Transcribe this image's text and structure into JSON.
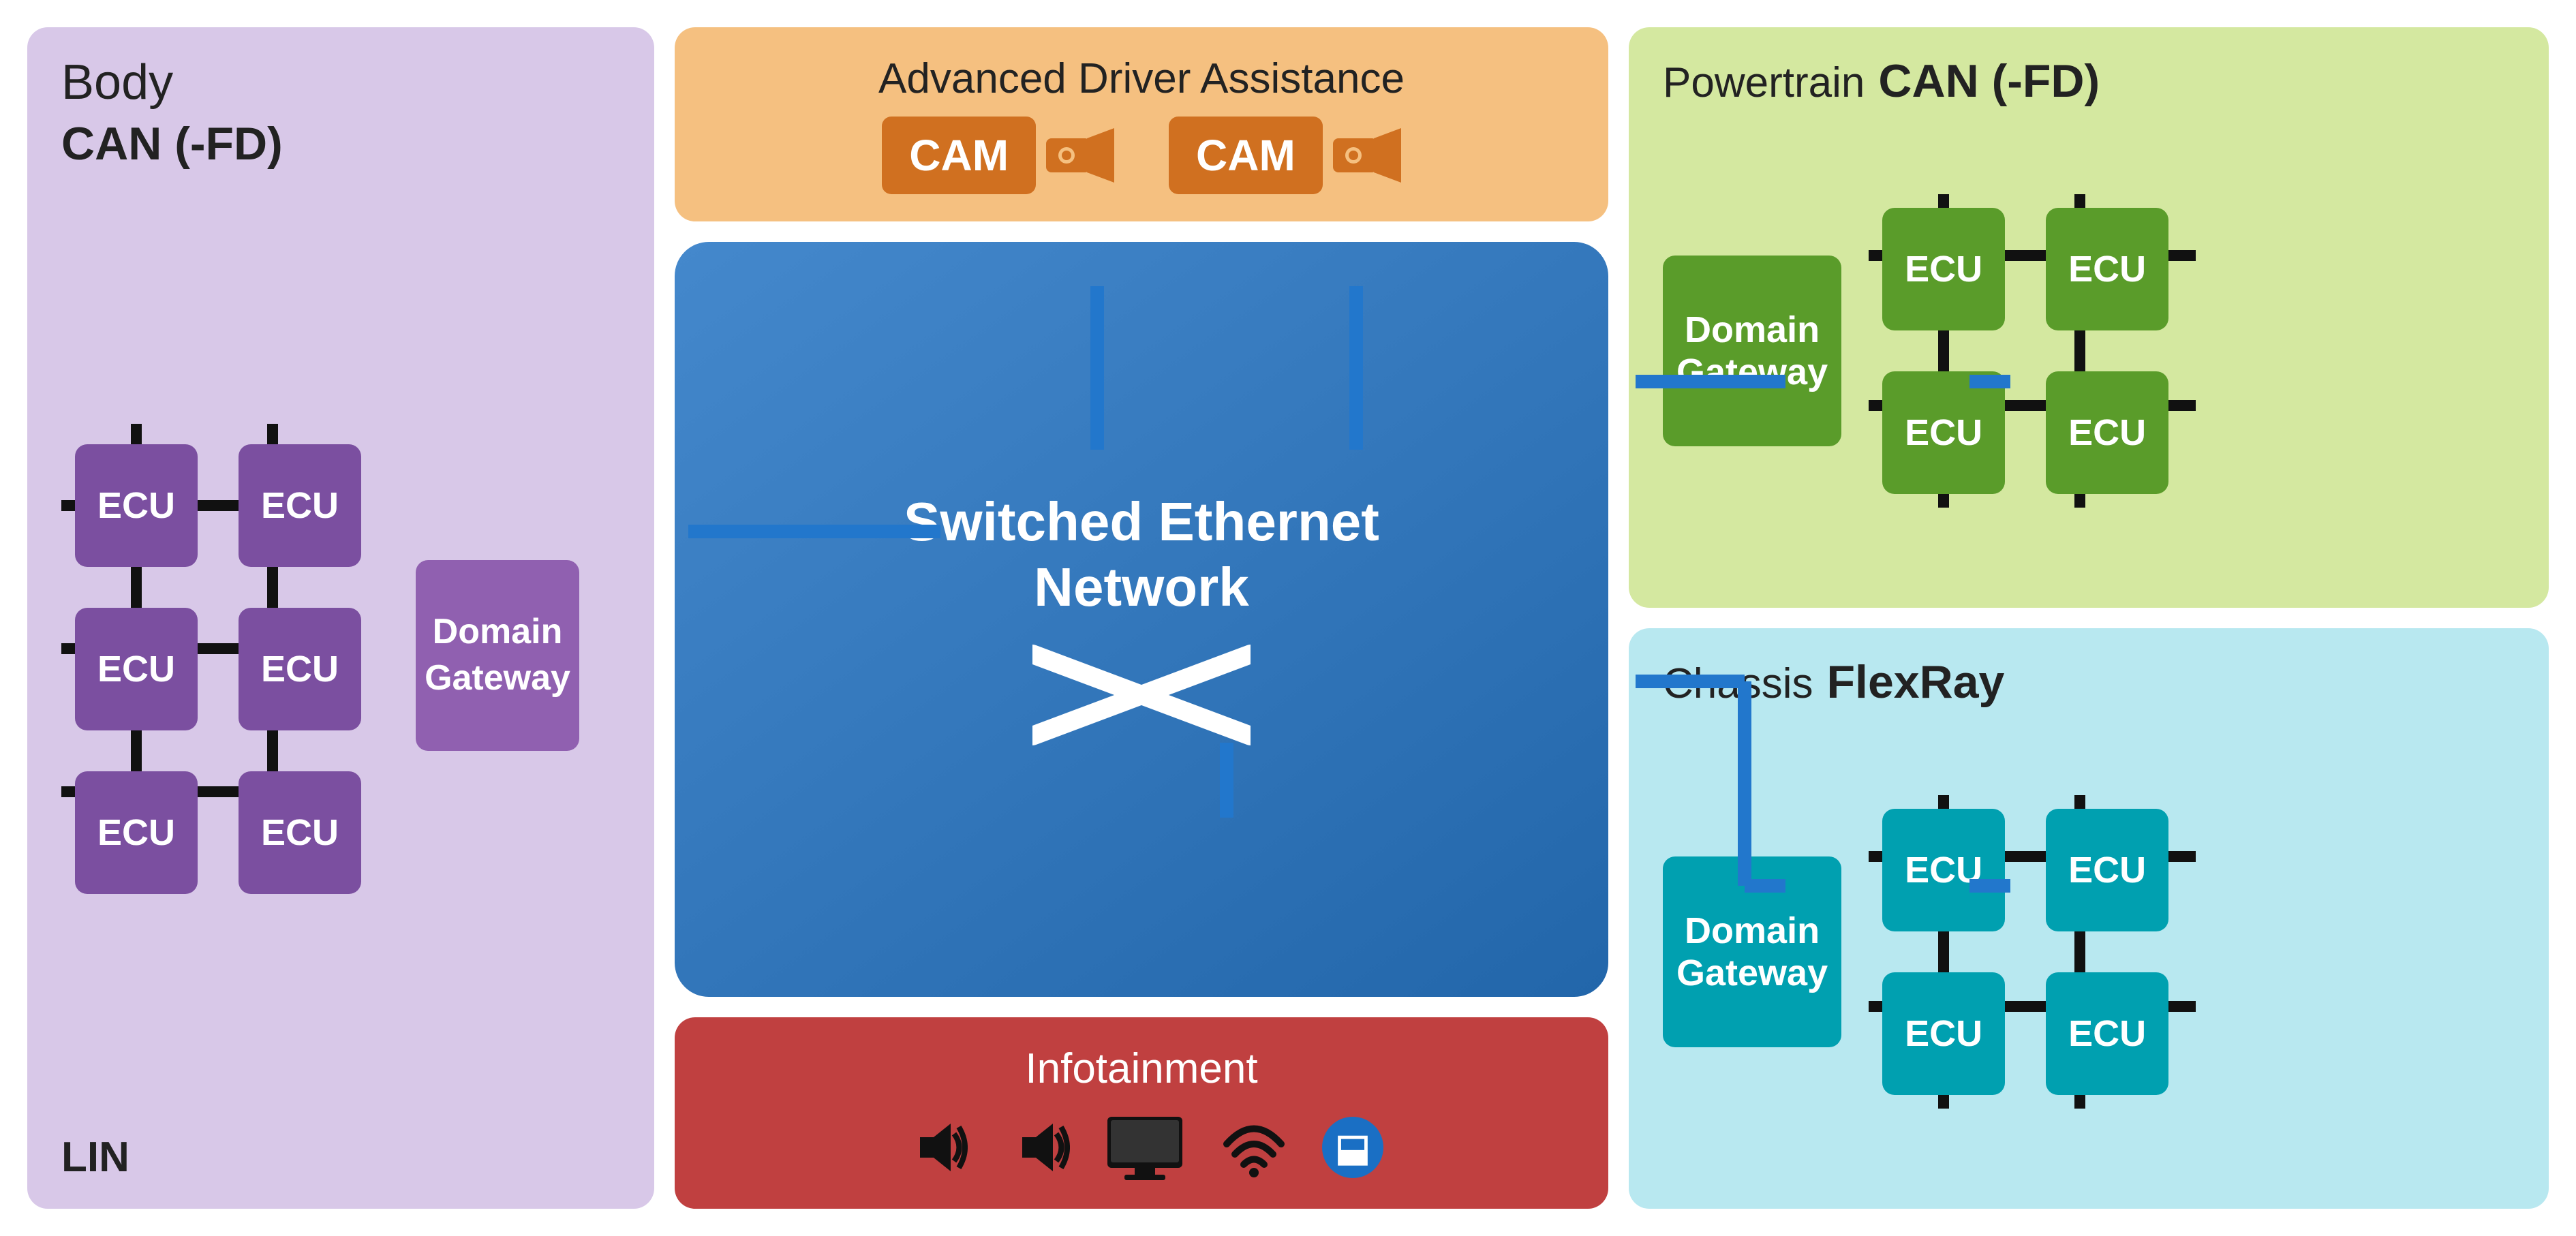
{
  "body": {
    "title": "Body",
    "subtitle": "CAN (-FD)",
    "lin_label": "LIN",
    "ecu_labels": [
      "ECU",
      "ECU",
      "ECU",
      "ECU",
      "ECU",
      "ECU"
    ],
    "domain_gw_label": "Domain\nGateway"
  },
  "adas": {
    "title": "Advanced Driver Assistance",
    "cam1_label": "CAM",
    "cam2_label": "CAM"
  },
  "ethernet": {
    "title": "Switched Ethernet\nNetwork"
  },
  "infotainment": {
    "title": "Infotainment"
  },
  "powertrain": {
    "title": "Powertrain",
    "subtitle": "CAN (-FD)",
    "domain_gw_label": "Domain\nGateway",
    "ecu_labels": [
      "ECU",
      "ECU",
      "ECU",
      "ECU"
    ]
  },
  "chassis": {
    "title": "Chassis",
    "subtitle": "FlexRay",
    "domain_gw_label": "Domain\nGateway",
    "ecu_labels": [
      "ECU",
      "ECU",
      "ECU",
      "ECU"
    ]
  }
}
